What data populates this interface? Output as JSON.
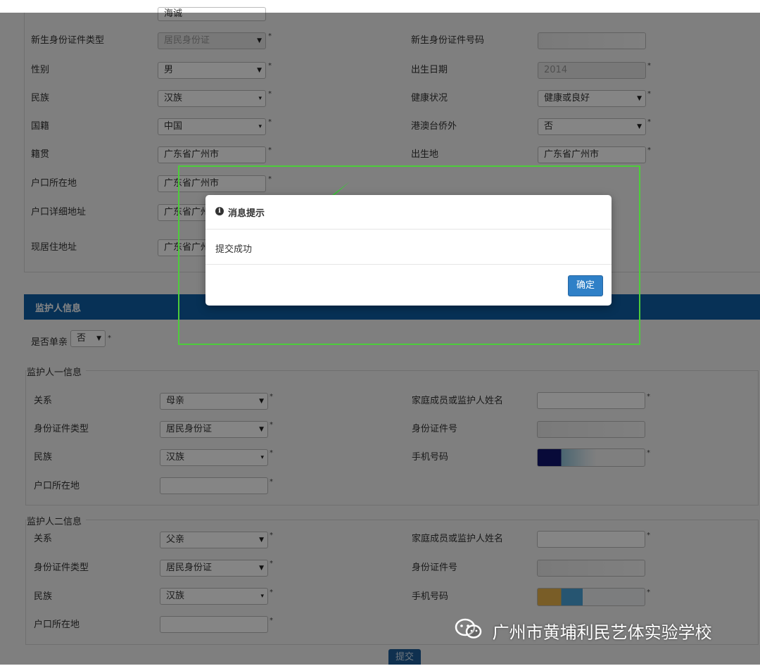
{
  "student": {
    "top_field_value": "海诚",
    "rows": [
      {
        "label": "新生身份证件类型",
        "value": "居民身份证",
        "disabled": true
      },
      {
        "label": "新生身份证件号码",
        "value": ""
      },
      {
        "label": "性别",
        "value": "男"
      },
      {
        "label": "出生日期",
        "value": "2014"
      },
      {
        "label": "民族",
        "value": "汉族"
      },
      {
        "label": "健康状况",
        "value": "健康或良好"
      },
      {
        "label": "国籍",
        "value": "中国"
      },
      {
        "label": "港澳台侨外",
        "value": "否"
      },
      {
        "label": "籍贯",
        "value": "广东省广州市"
      },
      {
        "label": "出生地",
        "value": "广东省广州市"
      },
      {
        "label": "户口所在地",
        "value": "广东省广州市"
      },
      {
        "label": "户口详细地址",
        "value": "广东省广州市"
      },
      {
        "label": "现居住地址",
        "value": "广东省广州市"
      }
    ]
  },
  "guardian_section": {
    "title": "监护人信息",
    "single_parent_label": "是否单亲",
    "single_parent_value": "否"
  },
  "guardian1": {
    "title": "监护人一信息",
    "relation_label": "关系",
    "relation_value": "母亲",
    "name_label": "家庭成员或监护人姓名",
    "name_value": "",
    "id_type_label": "身份证件类型",
    "id_type_value": "居民身份证",
    "id_no_label": "身份证件号",
    "id_no_value": "",
    "ethnic_label": "民族",
    "ethnic_value": "汉族",
    "phone_label": "手机号码",
    "hukou_label": "户口所在地",
    "hukou_value": ""
  },
  "guardian2": {
    "title": "监护人二信息",
    "relation_label": "关系",
    "relation_value": "父亲",
    "name_label": "家庭成员或监护人姓名",
    "name_value": "",
    "id_type_label": "身份证件类型",
    "id_type_value": "居民身份证",
    "id_no_label": "身份证件号",
    "id_no_value": "",
    "ethnic_label": "民族",
    "ethnic_value": "汉族",
    "phone_label": "手机号码",
    "hukou_label": "户口所在地",
    "hukou_value": ""
  },
  "submit_label": "提交",
  "required_mark": "*",
  "dialog": {
    "info_icon": "i",
    "title": "消息提示",
    "message": "提交成功",
    "ok_label": "确定"
  },
  "watermark": {
    "icon": "wechat-icon",
    "text": "广州市黄埔利民艺体实验学校"
  },
  "colors": {
    "header_bar": "#0e5fa6",
    "ok_button": "#2f80c7",
    "annotation_green": "#4dcc3b"
  }
}
